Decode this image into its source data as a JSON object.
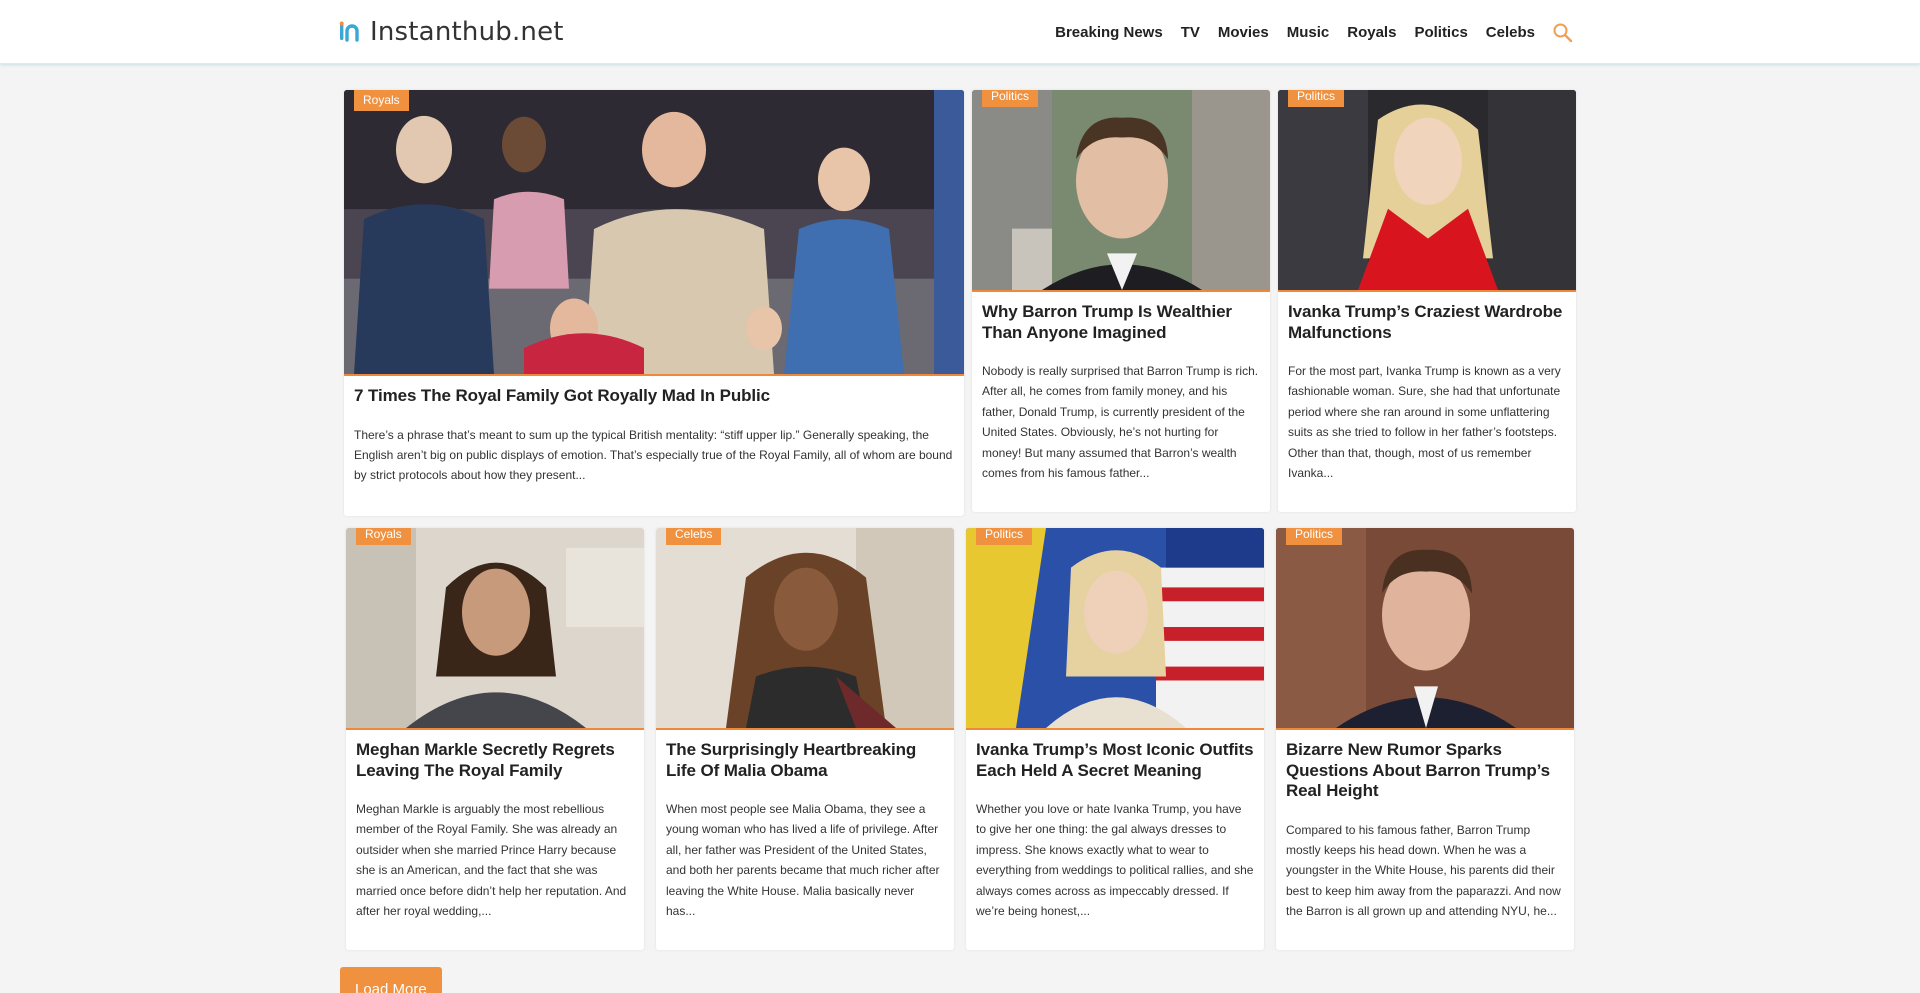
{
  "site": {
    "name": "Instanthub.net"
  },
  "nav": {
    "items": [
      "Breaking News",
      "TV",
      "Movies",
      "Music",
      "Royals",
      "Politics",
      "Celebs"
    ]
  },
  "colors": {
    "accent": "#f0913f",
    "logo_blue": "#3aa7d4",
    "header_border": "#d8ecef"
  },
  "icons": {
    "search": "search-icon"
  },
  "articles": [
    {
      "category": "Royals",
      "title": "7 Times The Royal Family Got Royally Mad In Public",
      "excerpt": "There’s a phrase that’s meant to sum up the typical British mentality: “stiff upper lip.” Generally speaking, the English aren’t big on public displays of emotion. That’s especially true of the Royal Family, all of whom are bound by strict protocols about how they present..."
    },
    {
      "category": "Politics",
      "title": "Why Barron Trump Is Wealthier Than Anyone Imagined",
      "excerpt": "Nobody is really surprised that Barron Trump is rich. After all, he comes from family money, and his father, Donald Trump, is currently president of the United States. Obviously, he’s not hurting for money! But many assumed that Barron’s wealth comes from his famous father..."
    },
    {
      "category": "Politics",
      "title": "Ivanka Trump’s Craziest Wardrobe Malfunctions",
      "excerpt": "For the most part, Ivanka Trump is known as a very fashionable woman. Sure, she had that unfortunate period where she ran around in some unflattering suits as she tried to follow in her father’s footsteps. Other than that, though, most of us remember Ivanka..."
    },
    {
      "category": "Royals",
      "title": "Meghan Markle Secretly Regrets Leaving The Royal Family",
      "excerpt": "Meghan Markle is arguably the most rebellious member of the Royal Family. She was already an outsider when she married Prince Harry because she is an American, and the fact that she was married once before didn’t help her reputation. And after her royal wedding,..."
    },
    {
      "category": "Celebs",
      "title": "The Surprisingly Heartbreaking Life Of Malia Obama",
      "excerpt": "When most people see Malia Obama, they see a young woman who has lived a life of privilege. After all, her father was President of the United States, and both her parents became that much richer after leaving the White House. Malia basically never has..."
    },
    {
      "category": "Politics",
      "title": "Ivanka Trump’s Most Iconic Outfits Each Held A Secret Meaning",
      "excerpt": "Whether you love or hate Ivanka Trump, you have to give her one thing: the gal always dresses to impress. She knows exactly what to wear to everything from weddings to political rallies, and she always comes across as impeccably dressed. If we’re being honest,..."
    },
    {
      "category": "Politics",
      "title": "Bizarre New Rumor Sparks Questions About Barron Trump’s Real Height",
      "excerpt": "Compared to his famous father, Barron Trump mostly keeps his head down. When he was a youngster in the White House, his parents did their best to keep him away from the paparazzi. And now the Barron is all grown up and attending NYU, he..."
    }
  ],
  "load_more": {
    "label": "Load More"
  }
}
